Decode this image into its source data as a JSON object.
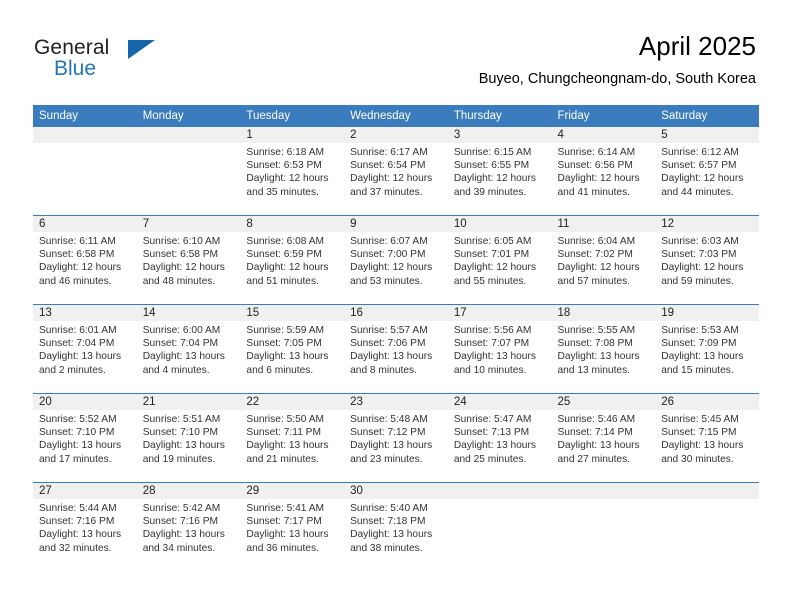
{
  "brand": {
    "name_top": "General",
    "name_bottom": "Blue",
    "accent_color": "#1565ab",
    "blue_text_color": "#2176bd"
  },
  "header": {
    "month_title": "April 2025",
    "location": "Buyeo, Chungcheongnam-do, South Korea"
  },
  "calendar": {
    "header_bg": "#3a7cbe",
    "daynum_band_bg": "#f0f0f0",
    "weekday_headers": [
      "Sunday",
      "Monday",
      "Tuesday",
      "Wednesday",
      "Thursday",
      "Friday",
      "Saturday"
    ],
    "weeks": [
      [
        {
          "day": "",
          "sunrise": "",
          "sunset": "",
          "daylight_1": "",
          "daylight_2": ""
        },
        {
          "day": "",
          "sunrise": "",
          "sunset": "",
          "daylight_1": "",
          "daylight_2": ""
        },
        {
          "day": "1",
          "sunrise": "Sunrise: 6:18 AM",
          "sunset": "Sunset: 6:53 PM",
          "daylight_1": "Daylight: 12 hours",
          "daylight_2": "and 35 minutes."
        },
        {
          "day": "2",
          "sunrise": "Sunrise: 6:17 AM",
          "sunset": "Sunset: 6:54 PM",
          "daylight_1": "Daylight: 12 hours",
          "daylight_2": "and 37 minutes."
        },
        {
          "day": "3",
          "sunrise": "Sunrise: 6:15 AM",
          "sunset": "Sunset: 6:55 PM",
          "daylight_1": "Daylight: 12 hours",
          "daylight_2": "and 39 minutes."
        },
        {
          "day": "4",
          "sunrise": "Sunrise: 6:14 AM",
          "sunset": "Sunset: 6:56 PM",
          "daylight_1": "Daylight: 12 hours",
          "daylight_2": "and 41 minutes."
        },
        {
          "day": "5",
          "sunrise": "Sunrise: 6:12 AM",
          "sunset": "Sunset: 6:57 PM",
          "daylight_1": "Daylight: 12 hours",
          "daylight_2": "and 44 minutes."
        }
      ],
      [
        {
          "day": "6",
          "sunrise": "Sunrise: 6:11 AM",
          "sunset": "Sunset: 6:58 PM",
          "daylight_1": "Daylight: 12 hours",
          "daylight_2": "and 46 minutes."
        },
        {
          "day": "7",
          "sunrise": "Sunrise: 6:10 AM",
          "sunset": "Sunset: 6:58 PM",
          "daylight_1": "Daylight: 12 hours",
          "daylight_2": "and 48 minutes."
        },
        {
          "day": "8",
          "sunrise": "Sunrise: 6:08 AM",
          "sunset": "Sunset: 6:59 PM",
          "daylight_1": "Daylight: 12 hours",
          "daylight_2": "and 51 minutes."
        },
        {
          "day": "9",
          "sunrise": "Sunrise: 6:07 AM",
          "sunset": "Sunset: 7:00 PM",
          "daylight_1": "Daylight: 12 hours",
          "daylight_2": "and 53 minutes."
        },
        {
          "day": "10",
          "sunrise": "Sunrise: 6:05 AM",
          "sunset": "Sunset: 7:01 PM",
          "daylight_1": "Daylight: 12 hours",
          "daylight_2": "and 55 minutes."
        },
        {
          "day": "11",
          "sunrise": "Sunrise: 6:04 AM",
          "sunset": "Sunset: 7:02 PM",
          "daylight_1": "Daylight: 12 hours",
          "daylight_2": "and 57 minutes."
        },
        {
          "day": "12",
          "sunrise": "Sunrise: 6:03 AM",
          "sunset": "Sunset: 7:03 PM",
          "daylight_1": "Daylight: 12 hours",
          "daylight_2": "and 59 minutes."
        }
      ],
      [
        {
          "day": "13",
          "sunrise": "Sunrise: 6:01 AM",
          "sunset": "Sunset: 7:04 PM",
          "daylight_1": "Daylight: 13 hours",
          "daylight_2": "and 2 minutes."
        },
        {
          "day": "14",
          "sunrise": "Sunrise: 6:00 AM",
          "sunset": "Sunset: 7:04 PM",
          "daylight_1": "Daylight: 13 hours",
          "daylight_2": "and 4 minutes."
        },
        {
          "day": "15",
          "sunrise": "Sunrise: 5:59 AM",
          "sunset": "Sunset: 7:05 PM",
          "daylight_1": "Daylight: 13 hours",
          "daylight_2": "and 6 minutes."
        },
        {
          "day": "16",
          "sunrise": "Sunrise: 5:57 AM",
          "sunset": "Sunset: 7:06 PM",
          "daylight_1": "Daylight: 13 hours",
          "daylight_2": "and 8 minutes."
        },
        {
          "day": "17",
          "sunrise": "Sunrise: 5:56 AM",
          "sunset": "Sunset: 7:07 PM",
          "daylight_1": "Daylight: 13 hours",
          "daylight_2": "and 10 minutes."
        },
        {
          "day": "18",
          "sunrise": "Sunrise: 5:55 AM",
          "sunset": "Sunset: 7:08 PM",
          "daylight_1": "Daylight: 13 hours",
          "daylight_2": "and 13 minutes."
        },
        {
          "day": "19",
          "sunrise": "Sunrise: 5:53 AM",
          "sunset": "Sunset: 7:09 PM",
          "daylight_1": "Daylight: 13 hours",
          "daylight_2": "and 15 minutes."
        }
      ],
      [
        {
          "day": "20",
          "sunrise": "Sunrise: 5:52 AM",
          "sunset": "Sunset: 7:10 PM",
          "daylight_1": "Daylight: 13 hours",
          "daylight_2": "and 17 minutes."
        },
        {
          "day": "21",
          "sunrise": "Sunrise: 5:51 AM",
          "sunset": "Sunset: 7:10 PM",
          "daylight_1": "Daylight: 13 hours",
          "daylight_2": "and 19 minutes."
        },
        {
          "day": "22",
          "sunrise": "Sunrise: 5:50 AM",
          "sunset": "Sunset: 7:11 PM",
          "daylight_1": "Daylight: 13 hours",
          "daylight_2": "and 21 minutes."
        },
        {
          "day": "23",
          "sunrise": "Sunrise: 5:48 AM",
          "sunset": "Sunset: 7:12 PM",
          "daylight_1": "Daylight: 13 hours",
          "daylight_2": "and 23 minutes."
        },
        {
          "day": "24",
          "sunrise": "Sunrise: 5:47 AM",
          "sunset": "Sunset: 7:13 PM",
          "daylight_1": "Daylight: 13 hours",
          "daylight_2": "and 25 minutes."
        },
        {
          "day": "25",
          "sunrise": "Sunrise: 5:46 AM",
          "sunset": "Sunset: 7:14 PM",
          "daylight_1": "Daylight: 13 hours",
          "daylight_2": "and 27 minutes."
        },
        {
          "day": "26",
          "sunrise": "Sunrise: 5:45 AM",
          "sunset": "Sunset: 7:15 PM",
          "daylight_1": "Daylight: 13 hours",
          "daylight_2": "and 30 minutes."
        }
      ],
      [
        {
          "day": "27",
          "sunrise": "Sunrise: 5:44 AM",
          "sunset": "Sunset: 7:16 PM",
          "daylight_1": "Daylight: 13 hours",
          "daylight_2": "and 32 minutes."
        },
        {
          "day": "28",
          "sunrise": "Sunrise: 5:42 AM",
          "sunset": "Sunset: 7:16 PM",
          "daylight_1": "Daylight: 13 hours",
          "daylight_2": "and 34 minutes."
        },
        {
          "day": "29",
          "sunrise": "Sunrise: 5:41 AM",
          "sunset": "Sunset: 7:17 PM",
          "daylight_1": "Daylight: 13 hours",
          "daylight_2": "and 36 minutes."
        },
        {
          "day": "30",
          "sunrise": "Sunrise: 5:40 AM",
          "sunset": "Sunset: 7:18 PM",
          "daylight_1": "Daylight: 13 hours",
          "daylight_2": "and 38 minutes."
        },
        {
          "day": "",
          "sunrise": "",
          "sunset": "",
          "daylight_1": "",
          "daylight_2": ""
        },
        {
          "day": "",
          "sunrise": "",
          "sunset": "",
          "daylight_1": "",
          "daylight_2": ""
        },
        {
          "day": "",
          "sunrise": "",
          "sunset": "",
          "daylight_1": "",
          "daylight_2": ""
        }
      ]
    ]
  }
}
